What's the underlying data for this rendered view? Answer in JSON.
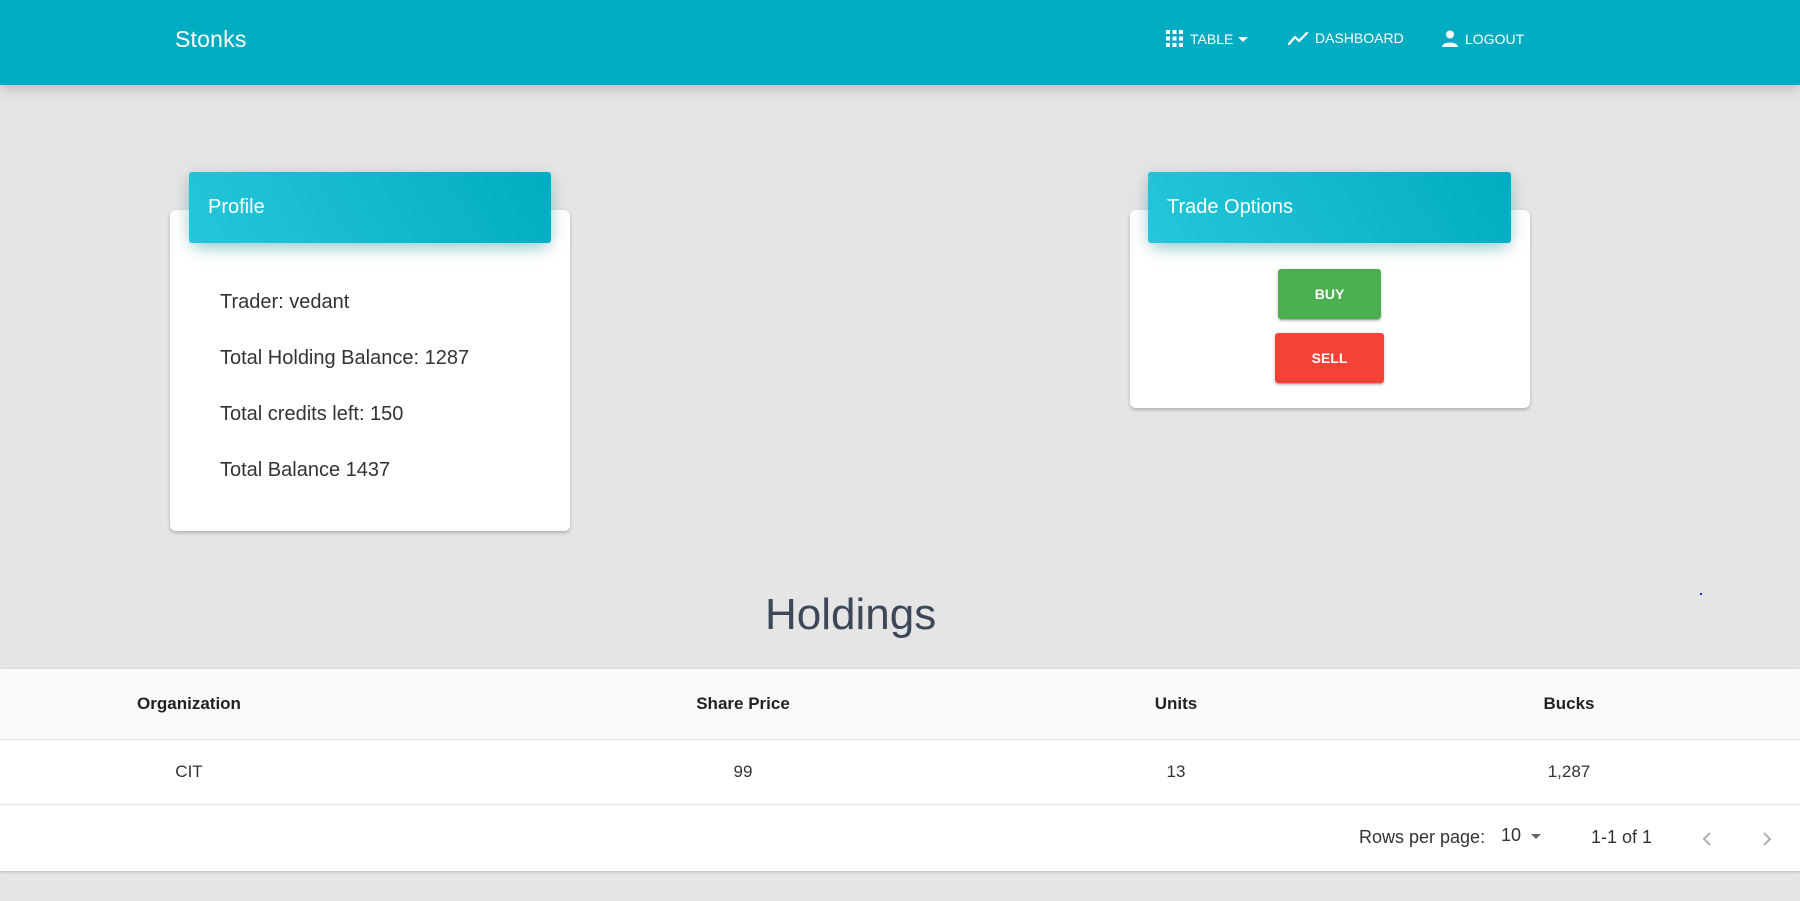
{
  "app": {
    "brand": "Stonks",
    "nav": [
      {
        "label": "TABLE",
        "icon": "apps-grid-icon"
      },
      {
        "label": "DASHBOARD",
        "icon": "trending-up-icon"
      },
      {
        "label": "LOGOUT",
        "icon": "person-icon"
      }
    ],
    "accent_color": "#00acc1"
  },
  "profile": {
    "title": "Profile",
    "lines": [
      "Trader: vedant",
      "Total Holding Balance: 1287",
      "Total credits left: 150",
      "Total Balance 1437"
    ]
  },
  "trade": {
    "title": "Trade Options",
    "buy_label": "BUY",
    "sell_label": "SELL",
    "buy_color": "#4caf50",
    "sell_color": "#f44336"
  },
  "holdings": {
    "title": "Holdings",
    "columns": [
      "Organization",
      "Share Price",
      "Units",
      "Bucks"
    ],
    "rows": [
      [
        "CIT",
        "99",
        "13",
        "1,287"
      ]
    ],
    "pager": {
      "rows_per_page_label": "Rows per page:",
      "rows_per_page_value": "10",
      "range_text": "1-1 of 1"
    }
  }
}
